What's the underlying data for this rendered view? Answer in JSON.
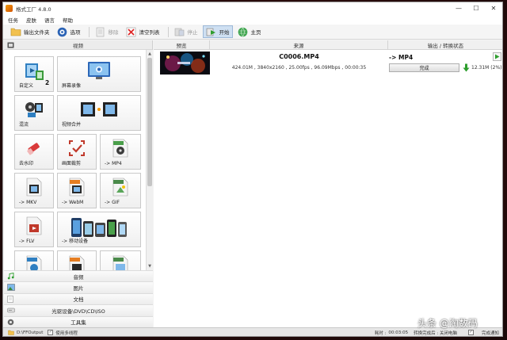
{
  "window": {
    "title": "格式工厂 4.8.0",
    "controls": [
      "—",
      "☐",
      "✕"
    ]
  },
  "menu": [
    "任务",
    "皮肤",
    "语言",
    "帮助"
  ],
  "toolbar": {
    "output_folder": "输出文件夹",
    "options": "选项",
    "remove": "移除",
    "clear_list": "清空列表",
    "stop": "停止",
    "start": "开始",
    "home": "主页"
  },
  "left": {
    "video_category": "视频",
    "tiles": [
      {
        "label": "自定义",
        "badge": "2"
      },
      {
        "label": "屏幕录像"
      },
      {
        "label": "混流"
      },
      {
        "label": "视频合并"
      },
      {
        "label": "去水印"
      },
      {
        "label": "画面裁剪"
      },
      {
        "label": "-> MP4"
      },
      {
        "label": "-> MKV"
      },
      {
        "label": "-> WebM"
      },
      {
        "label": "-> GIF"
      },
      {
        "label": "-> FLV"
      },
      {
        "label": "-> 移动设备"
      }
    ],
    "categories": [
      "音频",
      "图片",
      "文档",
      "光驱设备\\DVD\\CD\\ISO",
      "工具集"
    ]
  },
  "table": {
    "headers": {
      "preview": "预览",
      "source": "来源",
      "output": "输出 / 转换状态"
    },
    "task": {
      "filename": "C0006.MP4",
      "info": "424.01M , 3840x2160 , 25.00fps , 96.09Mbps , 00:00:35",
      "format": "-> MP4",
      "status": "完成",
      "output_size": "12.31M",
      "ratio": "(2%)"
    }
  },
  "status": {
    "folder": "D:\\FFOutput",
    "multithread": "使用多线程",
    "elapsed_label": "耗时 :",
    "elapsed": "00:03:05",
    "after_convert": "转换完成后 : 关闭电脑",
    "notify": "完成通知"
  },
  "watermark": "头条 @淘数码",
  "colors": {
    "accent_green": "#2e9e2e",
    "start_bg": "#cfe0f2",
    "desktop": "#3a1010"
  }
}
